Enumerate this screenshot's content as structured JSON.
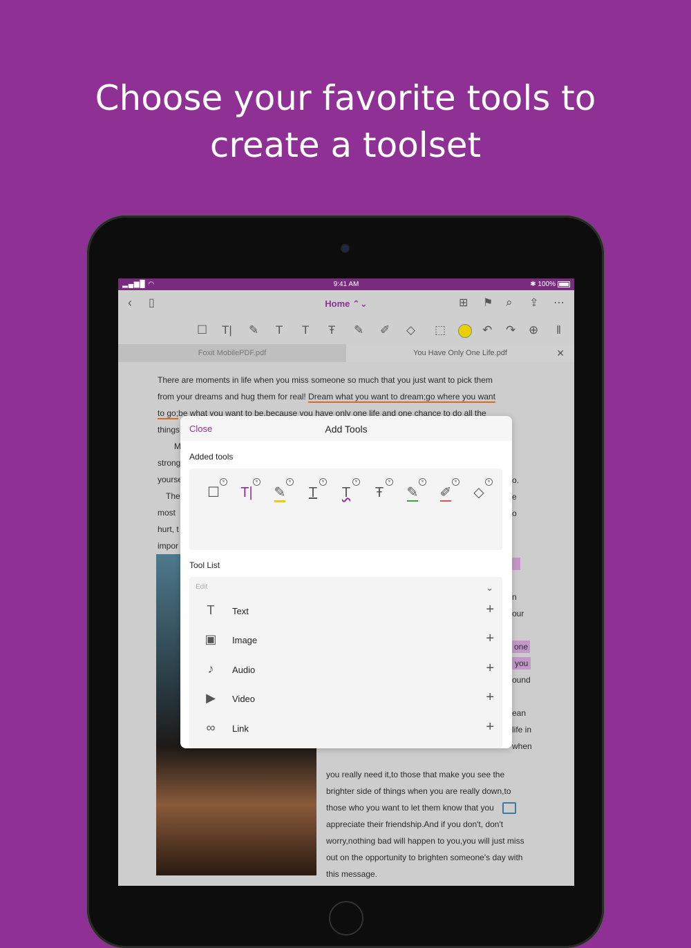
{
  "headline": {
    "line1": "Choose your favorite tools to",
    "line2": "create a toolset"
  },
  "status": {
    "signal": "▂▄▆█ ◠",
    "time": "9:41 AM",
    "battery": "✱ 100%"
  },
  "topbar": {
    "doc_title": "Home ⌃⌄"
  },
  "tabs": {
    "tab1": "Foxit MobilePDF.pdf",
    "tab2": "You Have Only One Life.pdf",
    "close": "✕"
  },
  "document": {
    "p1": "There are moments in life when you miss someone so much that you just want to pick them",
    "p2a": "from your dreams and hug them for real! ",
    "p2b": "Dream what you want to dream;go where you want",
    "p3a": "to go;",
    "p3b": "be what you want to be,because you have only one life and one chance to do all the",
    "p4": "things",
    "side": [
      "M",
      "strong",
      "yourse",
      "The",
      "most",
      "hurt, t",
      "impor"
    ],
    "right_frags": [
      "o.",
      "e",
      "o",
      "n",
      "our",
      "one",
      "you",
      "ound",
      "ean",
      "life in",
      "when"
    ],
    "lower": [
      "you really need it,to those that make you see the",
      "brighter side of things when you are really down,to",
      "those who you want to let them know that you",
      "appreciate their friendship.And if you don't, don't",
      "worry,nothing bad will happen to you,you will just miss",
      "out on the opportunity to brighten someone's day with",
      "this message."
    ]
  },
  "modal": {
    "close": "Close",
    "title": "Add Tools",
    "added_label": "Added tools",
    "added_tools": [
      {
        "icon": "note-icon",
        "glyph": "☐"
      },
      {
        "icon": "typewriter-icon",
        "glyph": "T|"
      },
      {
        "icon": "highlight-icon",
        "glyph": "✎"
      },
      {
        "icon": "underline-icon",
        "glyph": "T"
      },
      {
        "icon": "squiggly-icon",
        "glyph": "T"
      },
      {
        "icon": "strikeout-icon",
        "glyph": "Ŧ"
      },
      {
        "icon": "pencil-icon",
        "glyph": "✎"
      },
      {
        "icon": "eraser-highlight-icon",
        "glyph": "✐"
      },
      {
        "icon": "eraser-icon",
        "glyph": "◇"
      }
    ],
    "list_label": "Tool List",
    "category": "Edit",
    "tools": [
      {
        "label": "Text",
        "icon": "T"
      },
      {
        "label": "Image",
        "icon": "▣"
      },
      {
        "label": "Audio",
        "icon": "♪"
      },
      {
        "label": "Video",
        "icon": "▶"
      },
      {
        "label": "Link",
        "icon": "∞"
      }
    ]
  },
  "colors": {
    "brand": "#8f3094",
    "underline": "#d96a1e",
    "highlight": "#c497c9"
  }
}
